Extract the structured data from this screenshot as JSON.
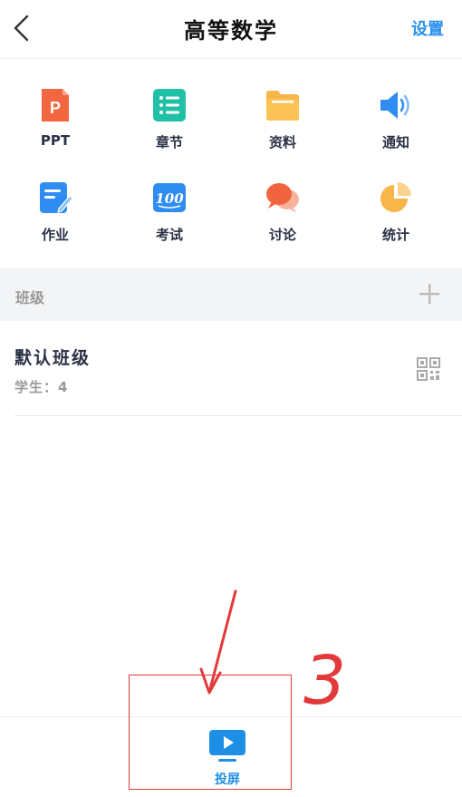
{
  "header": {
    "title": "高等数学",
    "settings_label": "设置"
  },
  "grid": [
    {
      "label": "PPT",
      "icon": "ppt-icon"
    },
    {
      "label": "章节",
      "icon": "list-icon"
    },
    {
      "label": "资料",
      "icon": "folder-icon"
    },
    {
      "label": "通知",
      "icon": "speaker-icon"
    },
    {
      "label": "作业",
      "icon": "homework-icon"
    },
    {
      "label": "考试",
      "icon": "exam-100-icon"
    },
    {
      "label": "讨论",
      "icon": "chat-bubbles-icon"
    },
    {
      "label": "统计",
      "icon": "pie-chart-icon"
    }
  ],
  "section": {
    "title": "班级"
  },
  "class": {
    "name": "默认班级",
    "students": "学生：4"
  },
  "bottom": {
    "cast_label": "投屏"
  },
  "annotation": {
    "number": "3"
  },
  "colors": {
    "accent": "#2a8ff0",
    "annotation": "#e23a3a"
  }
}
